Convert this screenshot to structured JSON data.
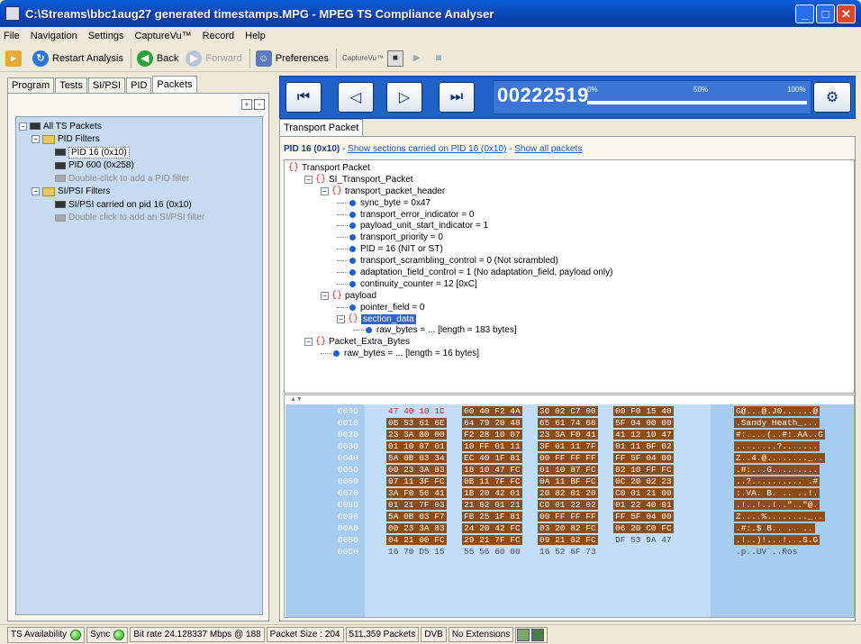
{
  "window": {
    "title": "C:\\Streams\\bbc1aug27 generated timestamps.MPG - MPEG TS Compliance Analyser",
    "min": "_",
    "max": "□",
    "close": "✕"
  },
  "menu": [
    "File",
    "Navigation",
    "Settings",
    "CaptureVu™",
    "Record",
    "Help"
  ],
  "toolbar": {
    "restart": "Restart Analysis",
    "back": "Back",
    "forward": "Forward",
    "preferences": "Preferences",
    "capturevu": "CaptureVu™"
  },
  "left": {
    "tabs": [
      "Program",
      "Tests",
      "SI/PSI",
      "PID",
      "Packets"
    ],
    "active_tab": "Packets",
    "tree": {
      "root": "All TS Packets",
      "pid_filters": "PID Filters",
      "pid16": "PID 16 (0x10)",
      "pid600": "PID 600 (0x258)",
      "add_pid": "Double-click to add a PID filter",
      "sipsi_filters": "SI/PSI Filters",
      "sipsi_pid16": "SI/PSI carried on pid 16 (0x10)",
      "add_sipsi": "Double click to add an SI/PSI filter"
    }
  },
  "player": {
    "counter": "00222519",
    "pct0": "0%",
    "pct50": "50%",
    "pct100": "100%",
    "progress": 0.0
  },
  "right": {
    "tab": "Transport Packet",
    "pid_label": "PID 16 (0x10)",
    "dash1": " - ",
    "link_sections": "Show sections carried on PID 16 (0x10)",
    "dash2": " - ",
    "link_all": "Show all packets",
    "tree": [
      {
        "text": "Transport Packet",
        "kind": "brace",
        "level": 0
      },
      {
        "text": "SI_Transport_Packet",
        "kind": "brace",
        "level": 1
      },
      {
        "text": "transport_packet_header",
        "kind": "brace",
        "level": 2
      },
      {
        "text": "sync_byte = 0x47",
        "kind": "field",
        "level": 3
      },
      {
        "text": "transport_error_indicator = 0",
        "kind": "field",
        "level": 3
      },
      {
        "text": "payload_unit_start_indicator = 1",
        "kind": "field",
        "level": 3
      },
      {
        "text": "transport_priority = 0",
        "kind": "field",
        "level": 3
      },
      {
        "text": "PID = 16 (NIT or ST)",
        "kind": "field",
        "level": 3
      },
      {
        "text": "transport_scrambling_control = 0 (Not scrambled)",
        "kind": "field",
        "level": 3
      },
      {
        "text": "adaptation_field_control = 1 (No adaptation_field, payload only)",
        "kind": "field",
        "level": 3
      },
      {
        "text": "continuity_counter = 12 [0xC]",
        "kind": "field",
        "level": 3
      },
      {
        "text": "payload",
        "kind": "brace",
        "level": 2
      },
      {
        "text": "pointer_field = 0",
        "kind": "field",
        "level": 3
      },
      {
        "text": "section_data",
        "kind": "brace-selected",
        "level": 3
      },
      {
        "text": "raw_bytes = ... [length = 183 bytes]",
        "kind": "field",
        "level": 4
      },
      {
        "text": "Packet_Extra_Bytes",
        "kind": "brace",
        "level": 1
      },
      {
        "text": "raw_bytes = ... [length = 16 bytes]",
        "kind": "field",
        "level": 2
      }
    ],
    "hex": [
      {
        "addr": "0000",
        "g": [
          "47 40 10 1C",
          "00 40 F2 4A",
          "30 02 C7 00",
          "00 F0 15 40"
        ],
        "asc": "G@...@.J0......@"
      },
      {
        "addr": "0010",
        "g": [
          "0B 53 61 6E",
          "64 79 20 48",
          "65 61 74 68",
          "5F 04 00 00"
        ],
        "asc": ".Sandy Heath_..."
      },
      {
        "addr": "0020",
        "g": [
          "23 3A 80 00",
          "F2 28 10 07",
          "23 3A F0 41",
          "41 12 10 47"
        ],
        "asc": "#:....(..#:.AA..G"
      },
      {
        "addr": "0030",
        "g": [
          "01 10 87 01",
          "10 FF 01 11",
          "3F 01 11 7F",
          "01 11 BF 02"
        ],
        "asc": "........?......."
      },
      {
        "addr": "0040",
        "g": [
          "5A 0B 03 34",
          "EC 40 1F 81",
          "00 FF FF FF",
          "FF 5F 04 00"
        ],
        "asc": "Z..4.@........_.."
      },
      {
        "addr": "0050",
        "g": [
          "00 23 3A 83",
          "18 10 47 FC",
          "01 10 87 FC",
          "02 10 FF FC"
        ],
        "asc": ".#:...G........."
      },
      {
        "addr": "0060",
        "g": [
          "07 11 3F FC",
          "0B 11 7F FC",
          "0A 11 BF FC",
          "0C 20 02 23"
        ],
        "asc": "..?.......... .#"
      },
      {
        "addr": "0070",
        "g": [
          "3A F0 56 41",
          "1B 20 42 01",
          "20 82 01 20",
          "C0 01 21 00"
        ],
        "asc": ":.VA. B. .. ..!."
      },
      {
        "addr": "0080",
        "g": [
          "01 21 7F 03",
          "21 82 01 21",
          "C0 01 22 02",
          "01 22 40 01"
        ],
        "asc": ".!..!..!..\"..\"@."
      },
      {
        "addr": "0090",
        "g": [
          "5A 0B 03 F7",
          "FB 25 1F 81",
          "00 FF FF FF",
          "FF 5F 04 00"
        ],
        "asc": "Z....%........_.."
      },
      {
        "addr": "00A0",
        "g": [
          "00 23 3A 83",
          "24 20 42 FC",
          "03 20 82 FC",
          "06 20 C0 FC"
        ],
        "asc": ".#:.$ B.. .. .."
      },
      {
        "addr": "00B0",
        "g": [
          "04 21 00 FC",
          "29 21 7F FC",
          "09 21 82 FC",
          "DF 53 9A 47"
        ],
        "asc": ".!..)!...!...S.G"
      },
      {
        "addr": "00C0",
        "g": [
          "16 70 D5 15",
          "55 56 60 00",
          "16 52 6F 73",
          ""
        ],
        "asc": ".p..UV`..Ros"
      }
    ]
  },
  "status": {
    "ts_availability": "TS Availability",
    "sync": "Sync",
    "bitrate": "Bit rate  24.128337 Mbps @ 188",
    "packet_size": "Packet Size : 204",
    "packets": "511,359 Packets",
    "dvb": "DVB",
    "extensions": "No Extensions"
  }
}
